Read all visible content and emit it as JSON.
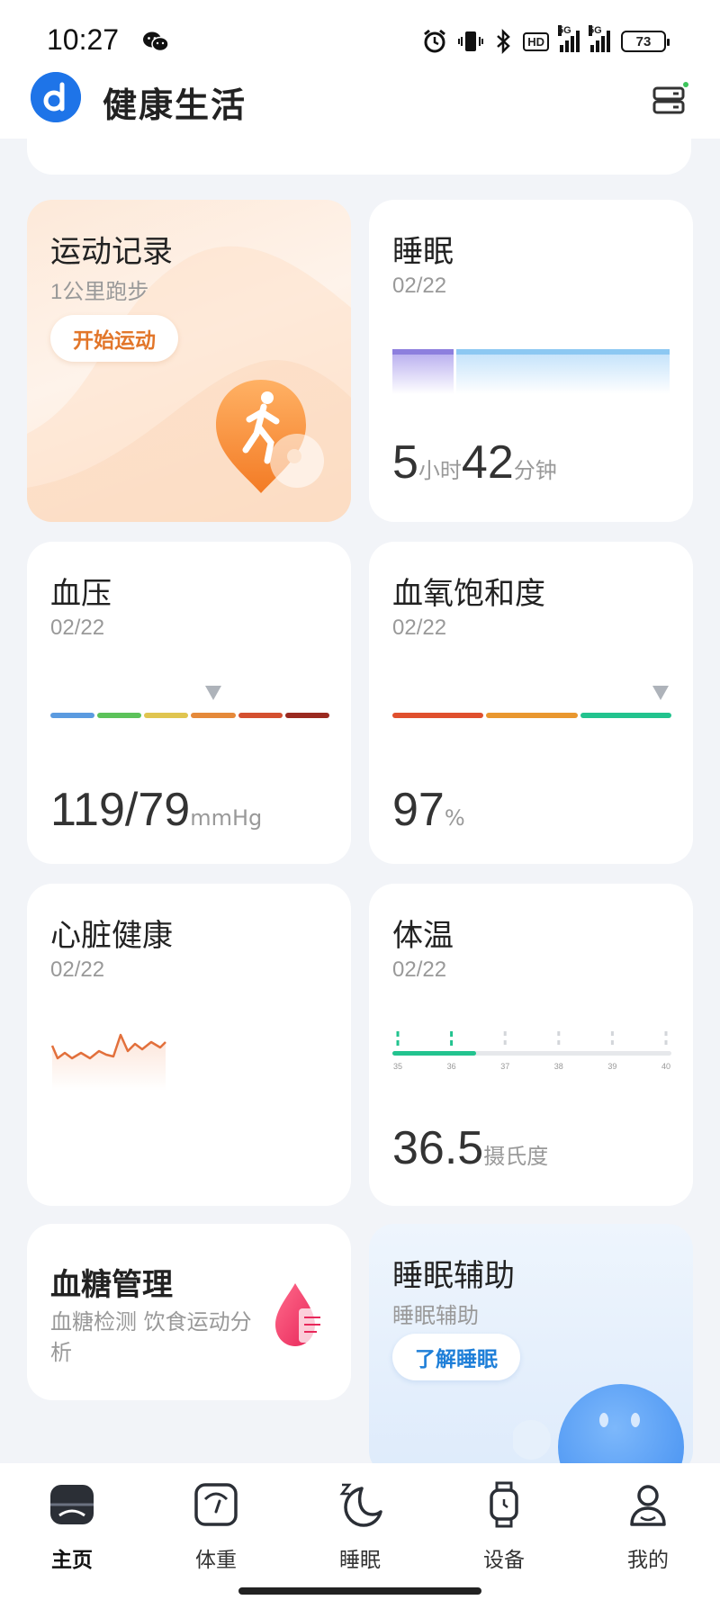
{
  "status_bar": {
    "time": "10:27",
    "hd": "HD",
    "network": "5G",
    "battery": "73"
  },
  "header": {
    "title": "健康生活"
  },
  "exercise": {
    "title": "运动记录",
    "subtitle": "1公里跑步",
    "button": "开始运动"
  },
  "sleep": {
    "title": "睡眠",
    "date": "02/22",
    "hours": "5",
    "hours_unit": "小时",
    "minutes": "42",
    "minutes_unit": "分钟"
  },
  "blood_pressure": {
    "title": "血压",
    "date": "02/22",
    "value": "119/79",
    "unit": "mmHg",
    "scale_colors": [
      "#5b9be0",
      "#5cc25a",
      "#e0c550",
      "#e5893a",
      "#d45030",
      "#9a2a20"
    ],
    "marker_segment": 4
  },
  "spo2": {
    "title": "血氧饱和度",
    "date": "02/22",
    "value": "97",
    "unit": "%",
    "scale_colors": [
      "#e0502e",
      "#e9972f",
      "#22c38e"
    ],
    "marker_segment": 3
  },
  "heart": {
    "title": "心脏健康",
    "date": "02/22"
  },
  "temperature": {
    "title": "体温",
    "date": "02/22",
    "value": "36.5",
    "unit": "摄氏度",
    "ticks": [
      "35",
      "36",
      "37",
      "38",
      "39",
      "40"
    ],
    "fill_fraction": 0.3
  },
  "blood_sugar": {
    "title": "血糖管理",
    "description": "血糖检测 饮食运动分析"
  },
  "sleep_aid": {
    "title": "睡眠辅助",
    "subtitle": "睡眠辅助",
    "button": "了解睡眠"
  },
  "nav": [
    {
      "label": "主页",
      "icon": "home-icon",
      "active": true
    },
    {
      "label": "体重",
      "icon": "scale-icon",
      "active": false
    },
    {
      "label": "睡眠",
      "icon": "moon-icon",
      "active": false
    },
    {
      "label": "设备",
      "icon": "watch-icon",
      "active": false
    },
    {
      "label": "我的",
      "icon": "profile-icon",
      "active": false
    }
  ]
}
